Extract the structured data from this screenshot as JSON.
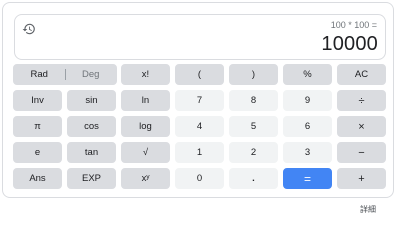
{
  "display": {
    "expression": "100 * 100 =",
    "result": "10000"
  },
  "keys": {
    "rad": "Rad",
    "deg": "Deg",
    "factorial": "x!",
    "open_paren": "(",
    "close_paren": ")",
    "percent": "%",
    "ac": "AC",
    "inv": "Inv",
    "sin": "sin",
    "ln": "ln",
    "seven": "7",
    "eight": "8",
    "nine": "9",
    "divide": "÷",
    "pi": "π",
    "cos": "cos",
    "log": "log",
    "four": "4",
    "five": "5",
    "six": "6",
    "multiply": "×",
    "e": "e",
    "tan": "tan",
    "sqrt": "√",
    "one": "1",
    "two": "2",
    "three": "3",
    "minus": "−",
    "ans": "Ans",
    "exp": "EXP",
    "power": "xʸ",
    "zero": "0",
    "dot": ".",
    "equals": "=",
    "plus": "+"
  },
  "footer": {
    "details_link": "詳細"
  },
  "colors": {
    "accent": "#4285f4",
    "function_key": "#dadce0",
    "number_key": "#f1f3f4"
  }
}
